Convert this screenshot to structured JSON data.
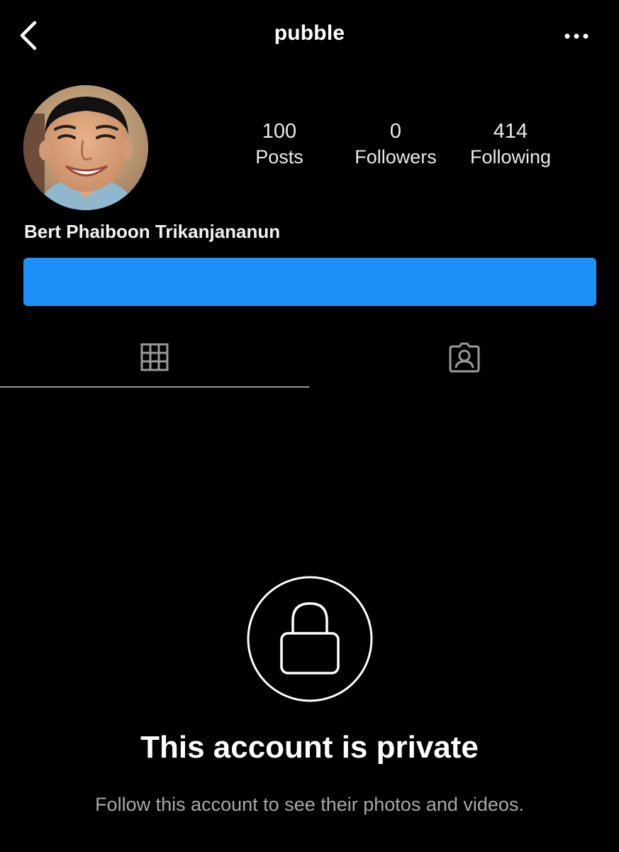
{
  "header": {
    "username": "pubble",
    "back_icon": "chevron-left-icon",
    "more_icon": "more-horizontal-icon"
  },
  "profile": {
    "full_name": "Bert Phaiboon Trikanjananun",
    "avatar": "profile-photo",
    "stats": [
      {
        "value": "100",
        "label": "Posts"
      },
      {
        "value": "0",
        "label": "Followers"
      },
      {
        "value": "414",
        "label": "Following"
      }
    ],
    "follow_button_label": ""
  },
  "tabs": [
    {
      "icon": "grid-icon",
      "selected": true
    },
    {
      "icon": "tagged-person-icon",
      "selected": false
    }
  ],
  "private": {
    "icon": "lock-icon",
    "title": "This account is private",
    "subtitle": "Follow this account to see their photos and videos."
  },
  "colors": {
    "background": "#000000",
    "button": "#1d91f9",
    "secondary_text": "#a8a8a8"
  }
}
